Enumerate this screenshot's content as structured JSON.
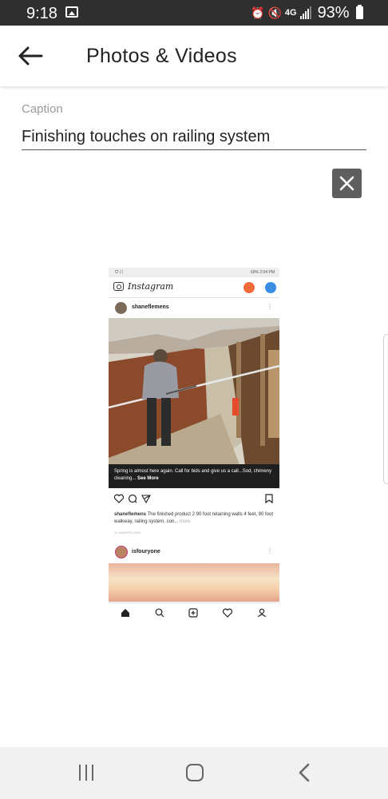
{
  "status_bar": {
    "time": "9:18",
    "network": "4G",
    "battery_percent": "93%"
  },
  "app_bar": {
    "title": "Photos & Videos"
  },
  "caption": {
    "label": "Caption",
    "value": "Finishing touches on railing system"
  },
  "attachment": {
    "status_left": "ᗜ ☐",
    "status_right": "69% 2:04 PM",
    "app_logo": "Instagram",
    "post_user": "shaneflemens",
    "photo_caption": "Spring is almost here again. Call for bids and give us a call...Sod, chimeny cleaning...",
    "photo_caption_more": "See More",
    "description_user": "shaneflemens",
    "description_text": "The finished product 2 90 foot retaining walls 4 feet, 90 foot walkway, railing system, con...",
    "description_more": "more",
    "time_ago": "11 MINUTES AGO",
    "second_user": "isfouryone"
  },
  "colors": {
    "status_bar": "#2f2f2f",
    "close_button": "#5f5f5f",
    "nav_bar": "#f1f1f1"
  }
}
